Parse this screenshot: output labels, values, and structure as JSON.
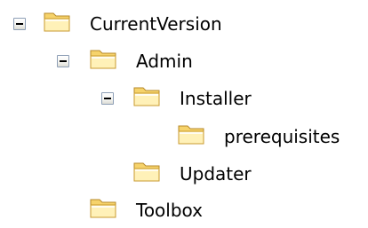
{
  "tree": {
    "nodes": [
      {
        "label": "CurrentVersion",
        "expanded": true,
        "icon": "folder-icon"
      },
      {
        "label": "Admin",
        "expanded": true,
        "icon": "folder-icon"
      },
      {
        "label": "Installer",
        "expanded": true,
        "icon": "folder-icon"
      },
      {
        "label": "prerequisites",
        "icon": "folder-icon"
      },
      {
        "label": "Updater",
        "icon": "folder-icon"
      },
      {
        "label": "Toolbox",
        "icon": "folder-icon"
      }
    ]
  },
  "colors": {
    "folder_light": "#fff1b8",
    "folder_mid": "#f6d36b",
    "folder_dark": "#d9a72d",
    "toggle_border": "#8e9fb6"
  }
}
